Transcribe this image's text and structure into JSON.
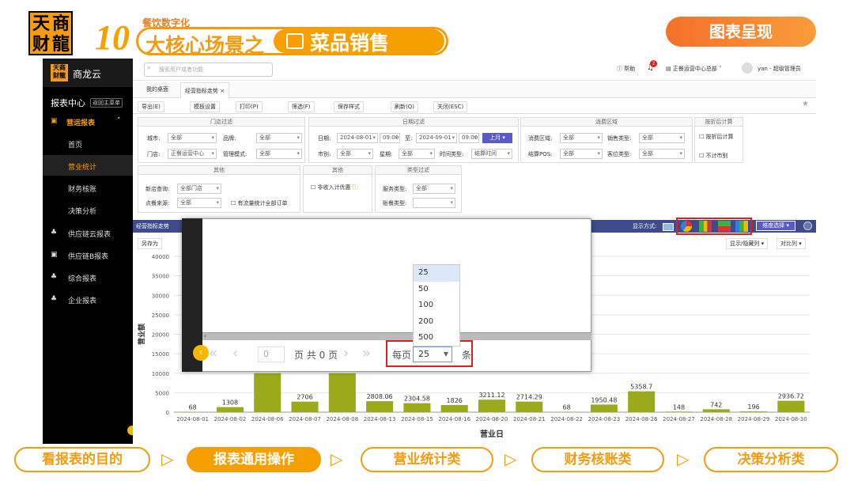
{
  "banner": {
    "logo_chars": [
      "天",
      "商",
      "财",
      "龍"
    ],
    "number": "10",
    "small": "餐饮数字化",
    "left": "大核心场景之",
    "right": "菜品销售",
    "top_button": "图表呈现"
  },
  "app": {
    "brand": "商龙云",
    "search_placeholder": "搜索用户或者功能",
    "top_help": "帮助",
    "badge": "2",
    "org": "正餐运营中心总部",
    "user": "yan - 超级管理员",
    "sidebar_title": "报表中心",
    "sidebar_back": "返回主菜单",
    "sidebar": [
      {
        "label": "营运报表",
        "active_group": true
      },
      {
        "label": "首页"
      },
      {
        "label": "营业统计",
        "active": true
      },
      {
        "label": "财务核账"
      },
      {
        "label": "决策分析"
      },
      {
        "label": "供应链云报表"
      },
      {
        "label": "供应链B报表"
      },
      {
        "label": "综合报表"
      },
      {
        "label": "企业报表"
      }
    ],
    "tabs": [
      "我的桌面",
      "经营指标走势"
    ],
    "toolbar": [
      "导出(E)",
      "模板设置",
      "打印(P)",
      "筛选(F)",
      "保存样式",
      "刷新(Q)",
      "关闭(ESC)"
    ],
    "filters": {
      "store_head": "门店过滤",
      "date_head": "日期过滤",
      "consume_head": "消费区域",
      "fold_head": "按折后计算",
      "other1_head": "其他",
      "other2_head": "其他",
      "type_head": "类型过滤",
      "city": "城市:",
      "city_val": "全部",
      "brand": "品牌:",
      "brand_val": "全部",
      "store": "门店:",
      "store_val": "正餐运营中心",
      "mgmt": "管理模式:",
      "mgmt_val": "全部",
      "date": "日期:",
      "date_from": "2024-08-01",
      "time_from": "09:00",
      "to": "至:",
      "date_to": "2024-09-01",
      "time_to": "09:00",
      "month_btn": "上月",
      "market": "市别:",
      "market_val": "全部",
      "week": "星期:",
      "week_val": "全部",
      "timetype": "时间类型:",
      "timetype_val": "结算时间",
      "area": "消费区域:",
      "area_val": "全部",
      "sales": "销售类型:",
      "sales_val": "全部",
      "pos": "结算POS:",
      "pos_val": "全部",
      "seat": "客位类型:",
      "seat_val": "全部",
      "fold_cb": "按折后计算",
      "nocount_cb": "不计市别",
      "newstore": "新店查询:",
      "newstore_val": "全部门店",
      "source": "点餐来源:",
      "source_val": "全部",
      "flow_cb": "有流量统计全部订单",
      "noncome_cb": "非收入计优惠",
      "service": "服务类型:",
      "service_val": "全部",
      "bill": "账餐类型:",
      "bill_val": ""
    },
    "panel_title": "经营指标走势",
    "display_mode": "显示方式:",
    "dim_btn": "维度选择",
    "saveas": "另存为",
    "showhide": "显示/隐藏列",
    "compare": "对比列"
  },
  "popup": {
    "page_num": "0",
    "page_text": "页 共 0 页",
    "per_page": "每页",
    "selected": "25",
    "unit": "条",
    "options": [
      "25",
      "50",
      "100",
      "200",
      "500"
    ]
  },
  "chart_data": {
    "type": "bar",
    "ylabel": "营业额",
    "xlabel": "营业日",
    "ylim": [
      0,
      40000
    ],
    "yticks": [
      0,
      5000,
      10000,
      15000,
      20000,
      25000,
      30000,
      35000,
      40000
    ],
    "categories": [
      "2024-08-01",
      "2024-08-02",
      "2024-08-06",
      "2024-08-07",
      "2024-08-08",
      "2024-08-13",
      "2024-08-15",
      "2024-08-16",
      "2024-08-20",
      "2024-08-21",
      "2024-08-22",
      "2024-08-23",
      "2024-08-26",
      "2024-08-27",
      "2024-08-28",
      "2024-08-29",
      "2024-08-30"
    ],
    "values": [
      68,
      1308,
      10000,
      2706,
      10000,
      2808.06,
      2304.58,
      1826,
      3211.12,
      2714.29,
      68,
      1950.48,
      5358.7,
      148,
      742,
      196,
      2936.72
    ],
    "labels": [
      "68",
      "1308",
      "",
      "2706",
      "",
      "2808.06",
      "2304.58",
      "1826",
      "3211.12",
      "2714.29",
      "68",
      "1950.48",
      "5358.7",
      "148",
      "742",
      "196",
      "2936.72"
    ],
    "bar_color": "#9aaa1a"
  },
  "bottom_nav": [
    "看报表的目的",
    "报表通用操作",
    "营业统计类",
    "财务核账类",
    "决策分析类"
  ],
  "colors": {
    "accent": "#f5a000",
    "red": "#e02020",
    "navy": "#3f4b8c"
  }
}
